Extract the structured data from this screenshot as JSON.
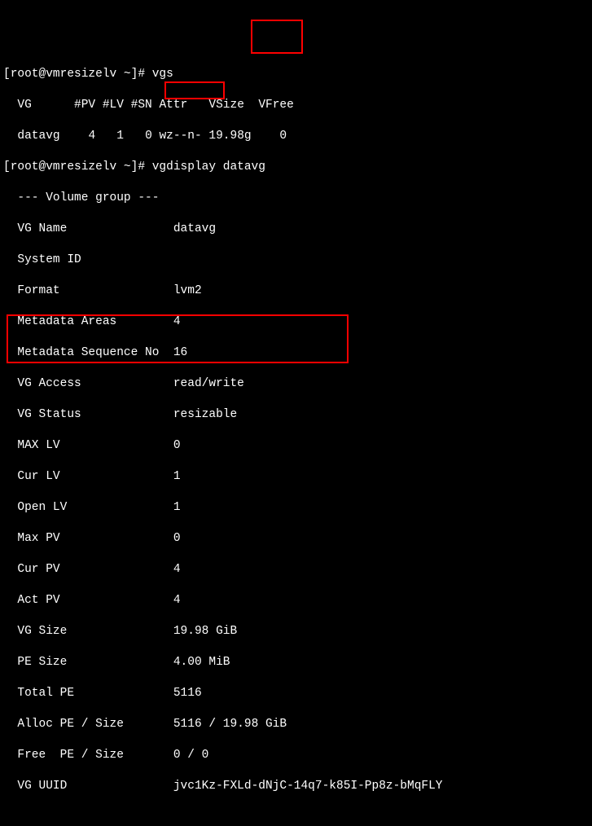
{
  "prompt1": {
    "user_host": "[root@vmresizelv ~]#",
    "cmd": "vgs"
  },
  "vgs_header": {
    "vg": "VG",
    "pv": "#PV",
    "lv": "#LV",
    "sn": "#SN",
    "attr": "Attr",
    "vsize": "VSize",
    "vfree": "VFree"
  },
  "vgs_row": {
    "vg": "datavg",
    "pv": "4",
    "lv": "1",
    "sn": "0",
    "attr": "wz--n-",
    "vsize": "19.98g",
    "vfree": "0"
  },
  "prompt2": {
    "user_host": "[root@vmresizelv ~]#",
    "cmd": "vgdisplay datavg"
  },
  "section_header": "--- Volume group ---",
  "fields": {
    "vg_name": {
      "label": "VG Name",
      "value": "datavg"
    },
    "system_id": {
      "label": "System ID",
      "value": ""
    },
    "format": {
      "label": "Format",
      "value": "lvm2"
    },
    "meta_areas": {
      "label": "Metadata Areas",
      "value": "4"
    },
    "meta_seq": {
      "label": "Metadata Sequence No",
      "value": "16"
    },
    "vg_access": {
      "label": "VG Access",
      "value": "read/write"
    },
    "vg_status": {
      "label": "VG Status",
      "value": "resizable"
    },
    "max_lv": {
      "label": "MAX LV",
      "value": "0"
    },
    "cur_lv": {
      "label": "Cur LV",
      "value": "1"
    },
    "open_lv": {
      "label": "Open LV",
      "value": "1"
    },
    "max_pv": {
      "label": "Max PV",
      "value": "0"
    },
    "cur_pv": {
      "label": "Cur PV",
      "value": "4"
    },
    "act_pv": {
      "label": "Act PV",
      "value": "4"
    },
    "vg_size": {
      "label": "VG Size",
      "value": "19.98 GiB"
    },
    "pe_size": {
      "label": "PE Size",
      "value": "4.00 MiB"
    },
    "total_pe": {
      "label": "Total PE",
      "value": "5116"
    },
    "alloc_pe": {
      "label": "Alloc PE / Size",
      "value": "5116 / 19.98 GiB"
    },
    "free_pe": {
      "label": "Free  PE / Size",
      "value": "0 / 0"
    },
    "vg_uuid": {
      "label": "VG UUID",
      "value": "jvc1Kz-FXLd-dNjC-14q7-k85I-Pp8z-bMqFLY"
    }
  },
  "highlight_color": "#ff0000"
}
